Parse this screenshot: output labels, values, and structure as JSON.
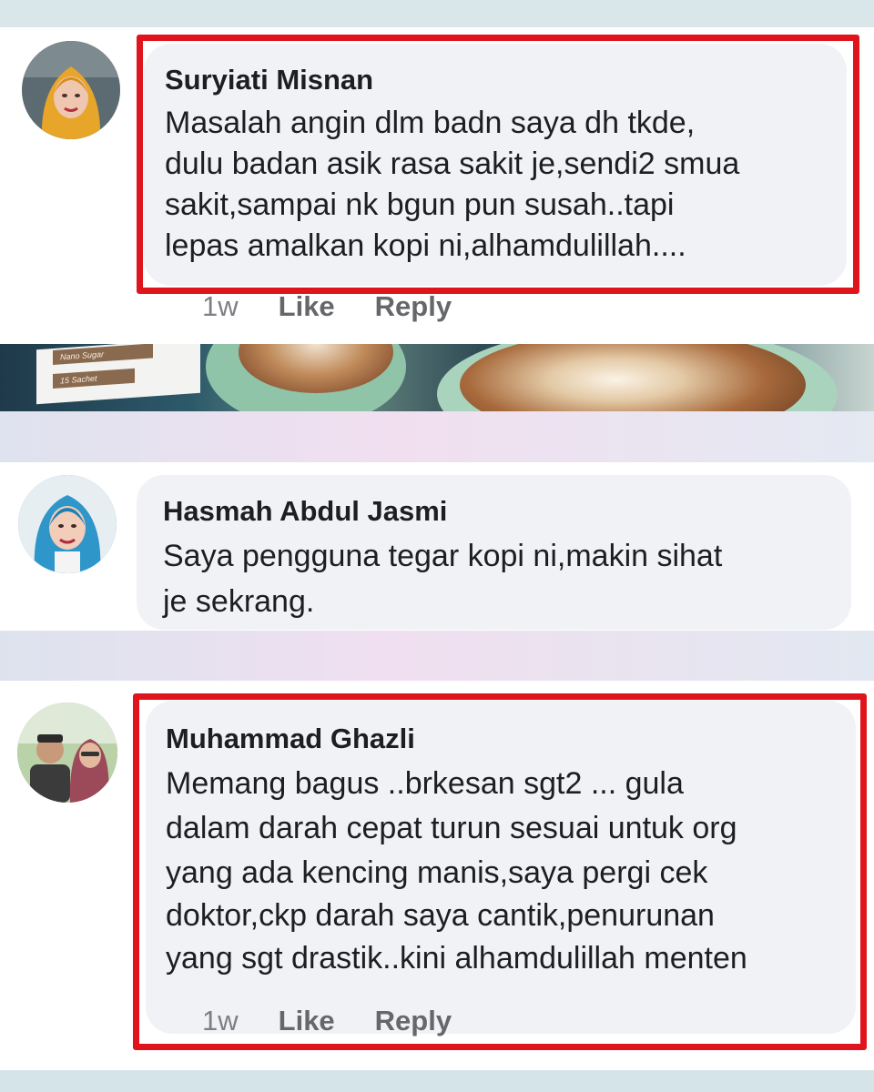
{
  "comments": [
    {
      "author": "Suryiati Misnan",
      "lines": [
        "Masalah angin dlm badn saya dh tkde,",
        "dulu badan asik rasa sakit je,sendi2 smua",
        "sakit,sampai nk bgun pun susah..tapi",
        "lepas amalkan kopi ni,alhamdulillah...."
      ],
      "time": "1w",
      "like_label": "Like",
      "reply_label": "Reply",
      "highlighted": true
    },
    {
      "author": "Hasmah Abdul Jasmi",
      "lines": [
        "Saya pengguna tegar kopi ni,makin sihat",
        "je sekrang."
      ],
      "highlighted": false
    },
    {
      "author": "Muhammad Ghazli",
      "lines": [
        "Memang bagus ..brkesan sgt2 ... gula",
        "dalam darah cepat turun sesuai untuk org",
        "yang ada kencing manis,saya pergi cek",
        "doktor,ckp darah saya cantik,penurunan",
        "yang sgt drastik..kini alhamdulillah menten"
      ],
      "time": "1w",
      "like_label": "Like",
      "reply_label": "Reply",
      "highlighted": true
    }
  ],
  "banner": {
    "box_label_1": "Nano Sugar",
    "box_label_2": "15 Sachet"
  },
  "colors": {
    "highlight": "#e0141c",
    "bubble": "#f0f2f5",
    "text": "#1c1e21",
    "meta": "#65676b"
  }
}
